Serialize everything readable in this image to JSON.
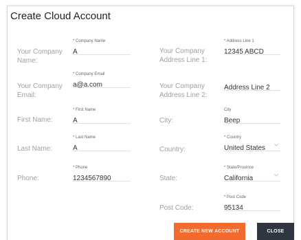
{
  "dialog": {
    "title": "Create Cloud Account"
  },
  "left": {
    "rows": [
      {
        "label": "Your Company Name:",
        "field_label": "* Company Name",
        "value": "A"
      },
      {
        "label": "Your Company Email:",
        "field_label": "* Company Email",
        "value": "a@a.com"
      },
      {
        "label": "First Name:",
        "field_label": "* First Name",
        "value": "A"
      },
      {
        "label": "Last Name:",
        "field_label": "* Last Name",
        "value": "A"
      },
      {
        "label": "Phone:",
        "field_label": "* Phone",
        "value": "1234567890"
      }
    ]
  },
  "right": {
    "rows": [
      {
        "label": "Your Company Address Line 1:",
        "field_label": "* Address Line 1",
        "value": "12345 ABCD"
      },
      {
        "label": "Your Company Address Line 2:",
        "field_label": "",
        "value": "Address Line 2"
      },
      {
        "label": "City:",
        "field_label": "City",
        "value": "Beep"
      },
      {
        "label": "Country:",
        "field_label": "* Country",
        "value": "United States"
      },
      {
        "label": "State:",
        "field_label": "* State/Province",
        "value": "California"
      },
      {
        "label": "Post Code:",
        "field_label": "* Post Code",
        "value": "95134"
      }
    ]
  },
  "buttons": {
    "create": "CREATE NEW ACCOUNT",
    "close": "CLOSE"
  },
  "colors": {
    "primary_button": "#f26a2e",
    "secondary_button": "#2f3640"
  },
  "icons": {
    "dropdown": "chevron-down-icon"
  }
}
